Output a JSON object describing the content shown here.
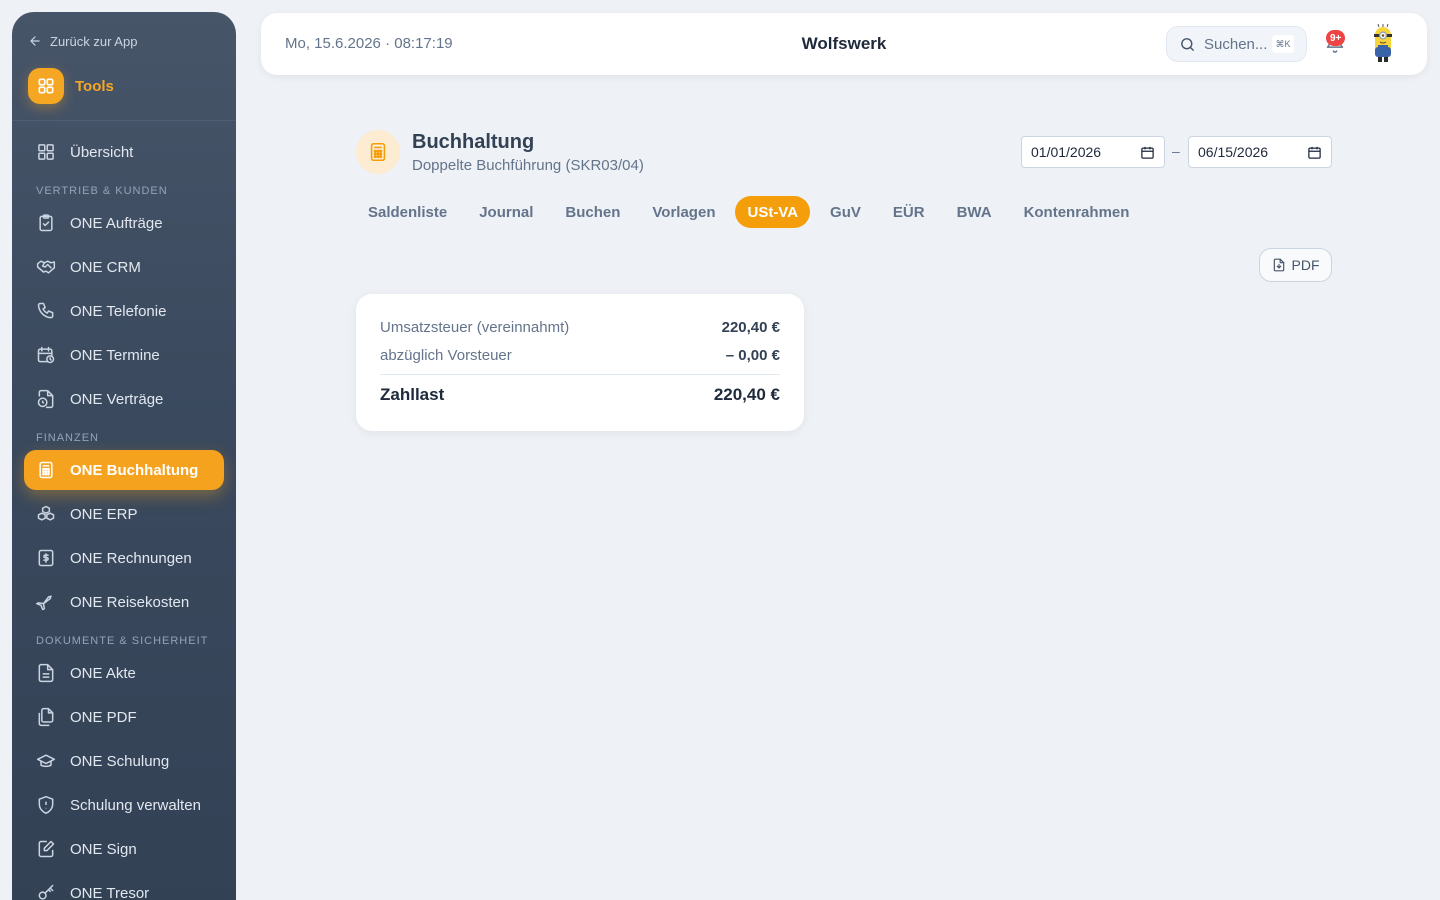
{
  "sidebar": {
    "back_label": "Zurück zur App",
    "tools_label": "Tools",
    "overview": "Übersicht",
    "sections": {
      "vertrieb": "VERTRIEB & KUNDEN",
      "finanzen": "FINANZEN",
      "dokumente": "DOKUMENTE & SICHERHEIT"
    },
    "items": {
      "auftraege": "ONE Aufträge",
      "crm": "ONE CRM",
      "telefonie": "ONE Telefonie",
      "termine": "ONE Termine",
      "vertraege": "ONE Verträge",
      "buchhaltung": "ONE Buchhaltung",
      "erp": "ONE ERP",
      "rechnungen": "ONE Rechnungen",
      "reisekosten": "ONE Reisekosten",
      "akte": "ONE Akte",
      "pdf": "ONE PDF",
      "schulung": "ONE Schulung",
      "schulung_verwalten": "Schulung verwalten",
      "sign": "ONE Sign",
      "tresor": "ONE Tresor"
    },
    "active_item": "ONE Buchhaltung"
  },
  "topbar": {
    "datetime": "Mo, 15.6.2026 · 08:17:19",
    "brand": "Wolfswerk",
    "search_placeholder": "Suchen...",
    "search_shortcut": "⌘K",
    "notification_count": "9+"
  },
  "page": {
    "title": "Buchhaltung",
    "subtitle": "Doppelte Buchführung (SKR03/04)",
    "date_from": "01/01/2026",
    "date_separator": "–",
    "date_to": "06/15/2026",
    "tabs": [
      "Saldenliste",
      "Journal",
      "Buchen",
      "Vorlagen",
      "USt-VA",
      "GuV",
      "EÜR",
      "BWA",
      "Kontenrahmen"
    ],
    "active_tab": "USt-VA",
    "pdf_button": "PDF"
  },
  "ust_va": {
    "umsatzsteuer_label": "Umsatzsteuer (vereinnahmt)",
    "umsatzsteuer_value": "220,40 €",
    "vorsteuer_label": "abzüglich Vorsteuer",
    "vorsteuer_value": "– 0,00 €",
    "zahllast_label": "Zahllast",
    "zahllast_value": "220,40 €"
  },
  "colors": {
    "accent": "#f59e0b",
    "sidebar_bg": "#3b4a5e",
    "badge_red": "#ef4444",
    "page_bg": "#eef1f5"
  }
}
